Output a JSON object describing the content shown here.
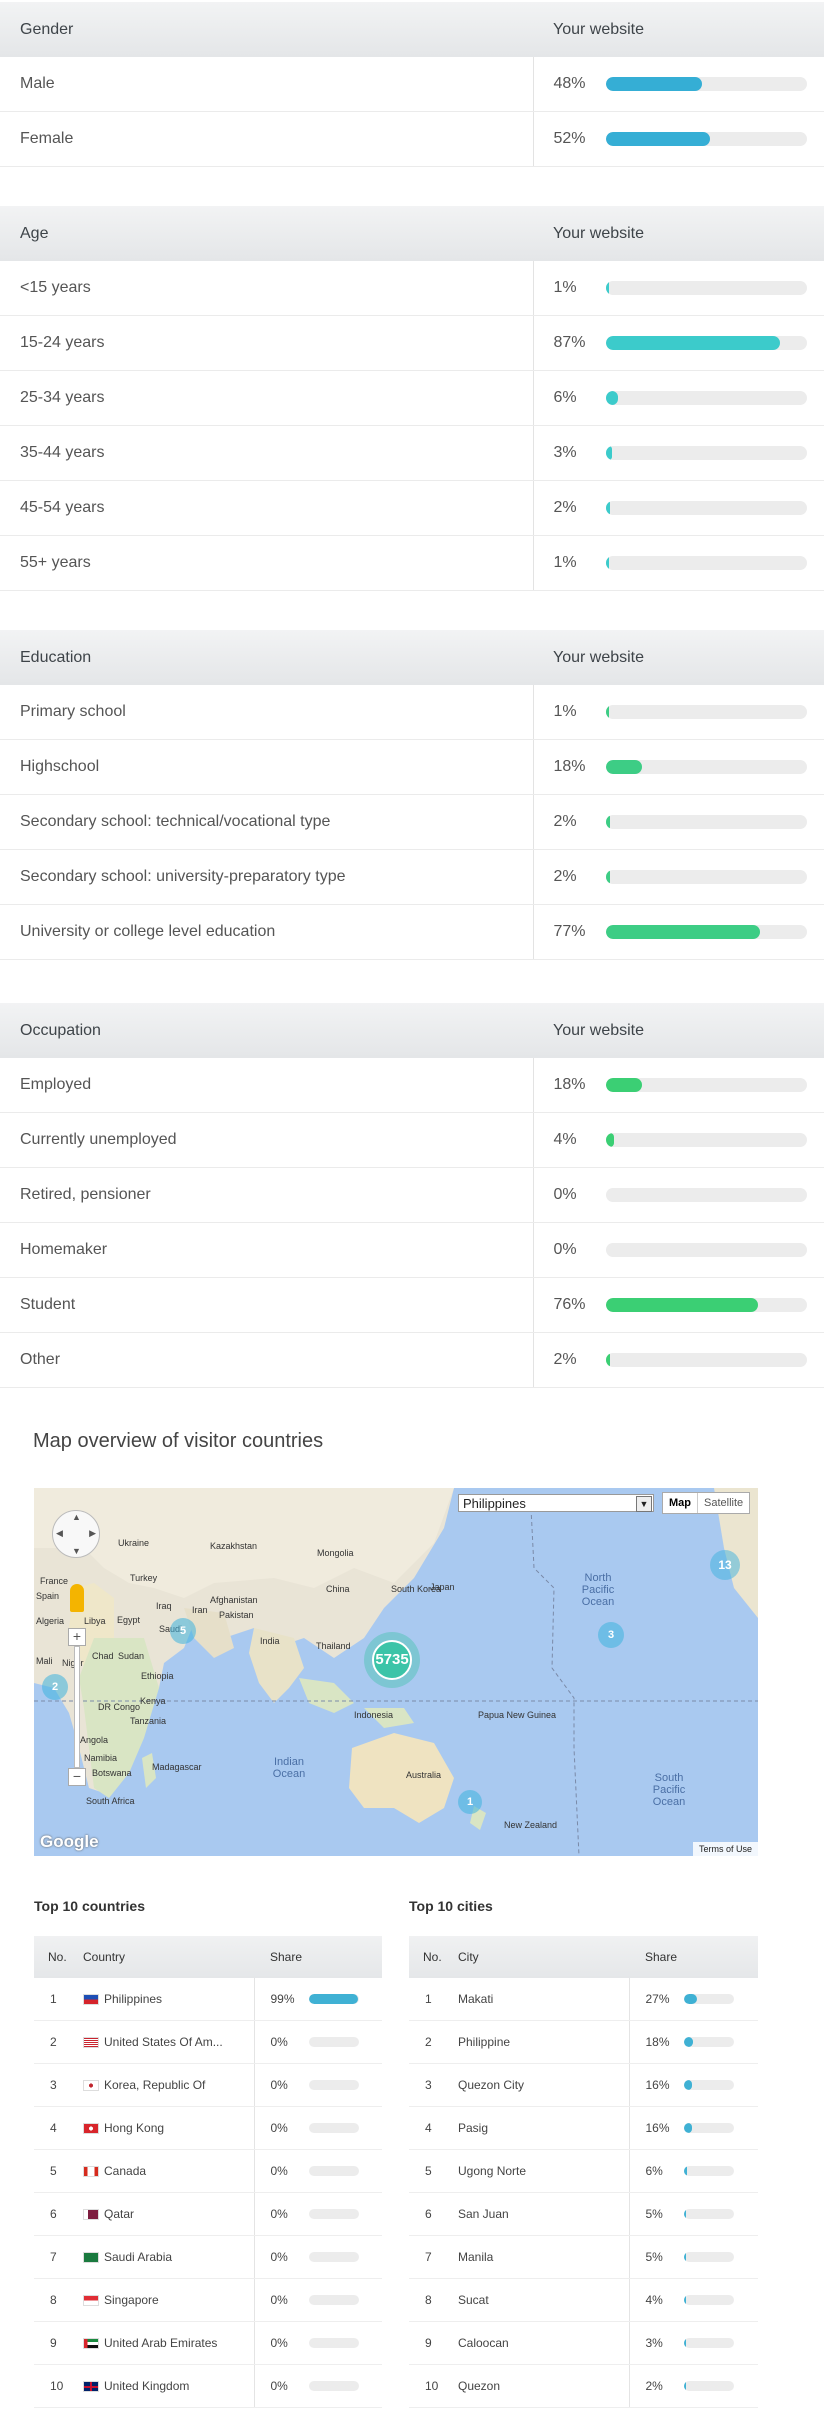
{
  "colors": {
    "blue": "#35aed5",
    "teal": "#3ccbcb",
    "green": "#3dcd85",
    "gbright": "#3bcf74"
  },
  "gender": {
    "header": "Gender",
    "col": "Your website",
    "rows": [
      {
        "label": "Male",
        "pct": "48%",
        "value": 48
      },
      {
        "label": "Female",
        "pct": "52%",
        "value": 52
      }
    ]
  },
  "age": {
    "header": "Age",
    "col": "Your website",
    "rows": [
      {
        "label": "<15 years",
        "pct": "1%",
        "value": 1
      },
      {
        "label": "15-24 years",
        "pct": "87%",
        "value": 87
      },
      {
        "label": "25-34 years",
        "pct": "6%",
        "value": 6
      },
      {
        "label": "35-44 years",
        "pct": "3%",
        "value": 3
      },
      {
        "label": "45-54 years",
        "pct": "2%",
        "value": 2
      },
      {
        "label": "55+ years",
        "pct": "1%",
        "value": 1
      }
    ]
  },
  "education": {
    "header": "Education",
    "col": "Your website",
    "rows": [
      {
        "label": "Primary school",
        "pct": "1%",
        "value": 1
      },
      {
        "label": "Highschool",
        "pct": "18%",
        "value": 18
      },
      {
        "label": "Secondary school: technical/vocational type",
        "pct": "2%",
        "value": 2
      },
      {
        "label": "Secondary school: university-preparatory type",
        "pct": "2%",
        "value": 2
      },
      {
        "label": "University or college level education",
        "pct": "77%",
        "value": 77
      }
    ]
  },
  "occupation": {
    "header": "Occupation",
    "col": "Your website",
    "rows": [
      {
        "label": "Employed",
        "pct": "18%",
        "value": 18
      },
      {
        "label": "Currently unemployed",
        "pct": "4%",
        "value": 4
      },
      {
        "label": "Retired, pensioner",
        "pct": "0%",
        "value": 0
      },
      {
        "label": "Homemaker",
        "pct": "0%",
        "value": 0
      },
      {
        "label": "Student",
        "pct": "76%",
        "value": 76
      },
      {
        "label": "Other",
        "pct": "2%",
        "value": 2
      }
    ]
  },
  "map": {
    "title": "Map overview of visitor countries",
    "select": "Philippines",
    "btn_map": "Map",
    "btn_sat": "Satellite",
    "terms": "Terms of Use",
    "google": "Google",
    "clusters": [
      "5735",
      "13",
      "3",
      "5",
      "2",
      "1"
    ],
    "labels": [
      "Kazakhstan",
      "Mongolia",
      "Ukraine",
      "Turkey",
      "China",
      "South Korea",
      "Japan",
      "Afghanistan",
      "Pakistan",
      "Iran",
      "Iraq",
      "Saudi",
      "Libya",
      "Egypt",
      "Algeria",
      "France",
      "Spain",
      "Chad",
      "Niger",
      "Mali",
      "Sudan",
      "Ethiopia",
      "Kenya",
      "DR Congo",
      "Tanzania",
      "Angola",
      "Namibia",
      "Botswana",
      "South Africa",
      "Madagascar",
      "India",
      "Thailand",
      "Indonesia",
      "Papua New Guinea",
      "Australia",
      "New Zealand"
    ],
    "oceans": [
      "North Pacific Ocean",
      "Indian Ocean",
      "South Pacific Ocean"
    ]
  },
  "countries": {
    "title": "Top 10 countries",
    "h_no": "No.",
    "h_name": "Country",
    "h_share": "Share",
    "rows": [
      {
        "no": "1",
        "name": "Philippines",
        "share": "99%",
        "value": 99,
        "flag": "ph"
      },
      {
        "no": "2",
        "name": "United States Of Am...",
        "share": "0%",
        "value": 0,
        "flag": "us"
      },
      {
        "no": "3",
        "name": "Korea, Republic Of",
        "share": "0%",
        "value": 0,
        "flag": "kr"
      },
      {
        "no": "4",
        "name": "Hong Kong",
        "share": "0%",
        "value": 0,
        "flag": "hk"
      },
      {
        "no": "5",
        "name": "Canada",
        "share": "0%",
        "value": 0,
        "flag": "ca"
      },
      {
        "no": "6",
        "name": "Qatar",
        "share": "0%",
        "value": 0,
        "flag": "qa"
      },
      {
        "no": "7",
        "name": "Saudi Arabia",
        "share": "0%",
        "value": 0,
        "flag": "sa"
      },
      {
        "no": "8",
        "name": "Singapore",
        "share": "0%",
        "value": 0,
        "flag": "sg"
      },
      {
        "no": "9",
        "name": "United Arab Emirates",
        "share": "0%",
        "value": 0,
        "flag": "ae"
      },
      {
        "no": "10",
        "name": "United Kingdom",
        "share": "0%",
        "value": 0,
        "flag": "gb"
      }
    ]
  },
  "cities": {
    "title": "Top 10 cities",
    "h_no": "No.",
    "h_name": "City",
    "h_share": "Share",
    "rows": [
      {
        "no": "1",
        "name": "Makati",
        "share": "27%",
        "value": 27
      },
      {
        "no": "2",
        "name": "Philippine",
        "share": "18%",
        "value": 18
      },
      {
        "no": "3",
        "name": "Quezon City",
        "share": "16%",
        "value": 16
      },
      {
        "no": "4",
        "name": "Pasig",
        "share": "16%",
        "value": 16
      },
      {
        "no": "5",
        "name": "Ugong Norte",
        "share": "6%",
        "value": 6
      },
      {
        "no": "6",
        "name": "San Juan",
        "share": "5%",
        "value": 5
      },
      {
        "no": "7",
        "name": "Manila",
        "share": "5%",
        "value": 5
      },
      {
        "no": "8",
        "name": "Sucat",
        "share": "4%",
        "value": 4
      },
      {
        "no": "9",
        "name": "Caloocan",
        "share": "3%",
        "value": 3
      },
      {
        "no": "10",
        "name": "Quezon",
        "share": "2%",
        "value": 2
      }
    ]
  }
}
